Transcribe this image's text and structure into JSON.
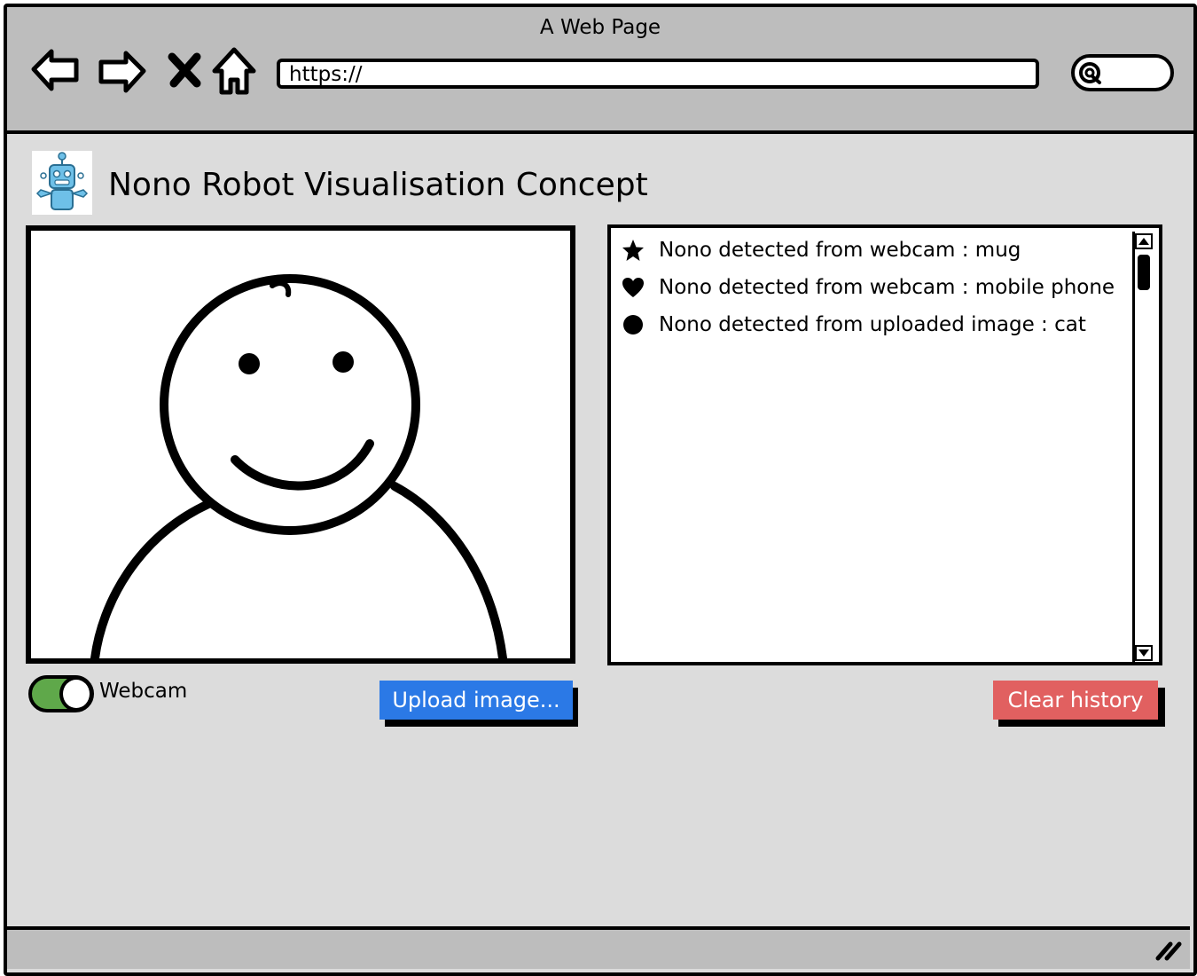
{
  "window": {
    "title": "A Web Page"
  },
  "browser": {
    "url": "https://",
    "search_placeholder": ""
  },
  "page": {
    "title": "Nono Robot Visualisation Concept"
  },
  "webcam": {
    "toggle_label": "Webcam",
    "toggle_on": true,
    "upload_button_label": "Upload image..."
  },
  "history": {
    "items": [
      {
        "icon": "star-icon",
        "text": "Nono detected from webcam : mug"
      },
      {
        "icon": "heart-icon",
        "text": "Nono detected from webcam : mobile phone"
      },
      {
        "icon": "circle-icon",
        "text": "Nono detected from uploaded image : cat"
      }
    ],
    "clear_button_label": "Clear history"
  },
  "colors": {
    "window_bg": "#dcdcdc",
    "bar_bg": "#bdbdbd",
    "toggle_on": "#5fa84a",
    "upload_button": "#2b79e6",
    "clear_button": "#e16060",
    "logo_robot": "#6ec0e8"
  }
}
